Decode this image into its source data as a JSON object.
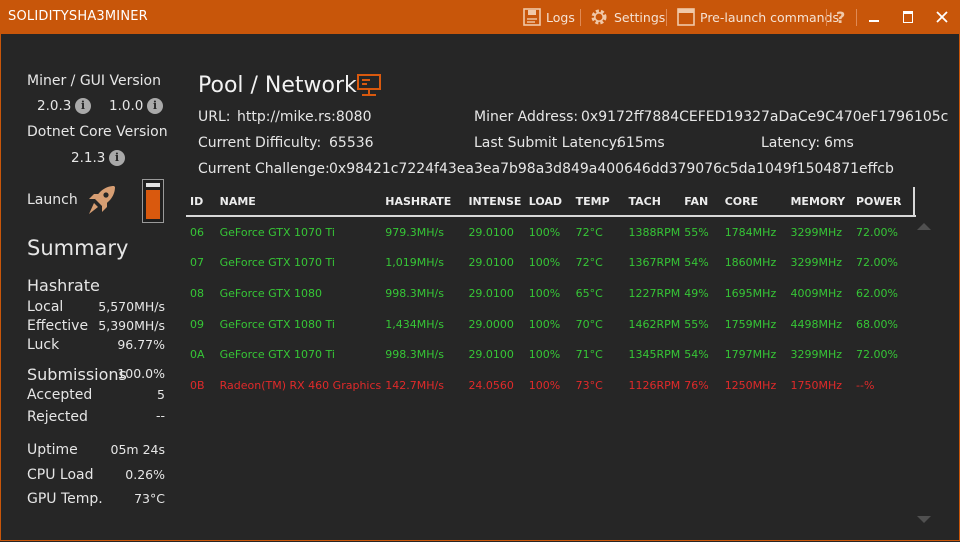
{
  "window": {
    "title": "SOLIDITYSHA3MINER",
    "logs": "Logs",
    "settings": "Settings",
    "prelaunch": "Pre-launch commands",
    "help": "?"
  },
  "sidebar": {
    "version_label": "Miner / GUI Version",
    "miner_version": "2.0.3",
    "gui_version": "1.0.0",
    "dotnet_label": "Dotnet Core Version",
    "dotnet_version": "2.1.3",
    "launch_label": "Launch",
    "summary_title": "Summary",
    "hashrate_title": "Hashrate",
    "local_label": "Local",
    "local_value": "5,570MH/s",
    "effective_label": "Effective",
    "effective_value": "5,390MH/s",
    "luck_label": "Luck",
    "luck_value": "96.77%",
    "submissions_title": "Submissions",
    "submissions_value": "100.0%",
    "accepted_label": "Accepted",
    "accepted_value": "5",
    "rejected_label": "Rejected",
    "rejected_value": "--",
    "uptime_label": "Uptime",
    "uptime_value": "05m 24s",
    "cpu_label": "CPU Load",
    "cpu_value": "0.26%",
    "gpu_label": "GPU Temp.",
    "gpu_value": "73°C"
  },
  "network": {
    "title": "Pool / Network",
    "url_label": "URL:",
    "url_value": "http://mike.rs:8080",
    "miner_address_label": "Miner Address:",
    "miner_address_value": "0x9172ff7884CEFED19327aDaCe9C470eF1796105c",
    "difficulty_label": "Current Difficulty:",
    "difficulty_value": "65536",
    "submit_latency_label": "Last Submit Latency:",
    "submit_latency_value": "615ms",
    "latency_label": "Latency:",
    "latency_value": "6ms",
    "challenge_label": "Current Challenge:",
    "challenge_value": "0x98421c7224f43ea3ea7b98a3d849a400646dd379076c5da1049f1504871effcb"
  },
  "table": {
    "headers": [
      "ID",
      "NAME",
      "HASHRATE",
      "INTENSE",
      "LOAD",
      "TEMP",
      "TACH",
      "FAN",
      "CORE",
      "MEMORY",
      "POWER"
    ],
    "rows": [
      [
        "06",
        "GeForce GTX 1070 Ti",
        "979.3MH/s",
        "29.0100",
        "100%",
        "72°C",
        "1388RPM",
        "55%",
        "1784MHz",
        "3299MHz",
        "72.00%"
      ],
      [
        "07",
        "GeForce GTX 1070 Ti",
        "1,019MH/s",
        "29.0100",
        "100%",
        "72°C",
        "1367RPM",
        "54%",
        "1860MHz",
        "3299MHz",
        "72.00%"
      ],
      [
        "08",
        "GeForce GTX 1080",
        "998.3MH/s",
        "29.0100",
        "100%",
        "65°C",
        "1227RPM",
        "49%",
        "1695MHz",
        "4009MHz",
        "62.00%"
      ],
      [
        "09",
        "GeForce GTX 1080 Ti",
        "1,434MH/s",
        "29.0000",
        "100%",
        "70°C",
        "1462RPM",
        "55%",
        "1759MHz",
        "4498MHz",
        "68.00%"
      ],
      [
        "0A",
        "GeForce GTX 1070 Ti",
        "998.3MH/s",
        "29.0100",
        "100%",
        "71°C",
        "1345RPM",
        "54%",
        "1797MHz",
        "3299MHz",
        "72.00%"
      ],
      [
        "0B",
        "Radeon(TM) RX 460 Graphics",
        "142.7MH/s",
        "24.0560",
        "100%",
        "73°C",
        "1126RPM",
        "76%",
        "1250MHz",
        "1750MHz",
        "--%"
      ]
    ],
    "row_status": [
      "ok",
      "ok",
      "ok",
      "ok",
      "ok",
      "bad"
    ]
  },
  "colors": {
    "accent": "#c8560a",
    "ok": "#36c636",
    "error": "#e02a2a",
    "background": "#262626"
  }
}
